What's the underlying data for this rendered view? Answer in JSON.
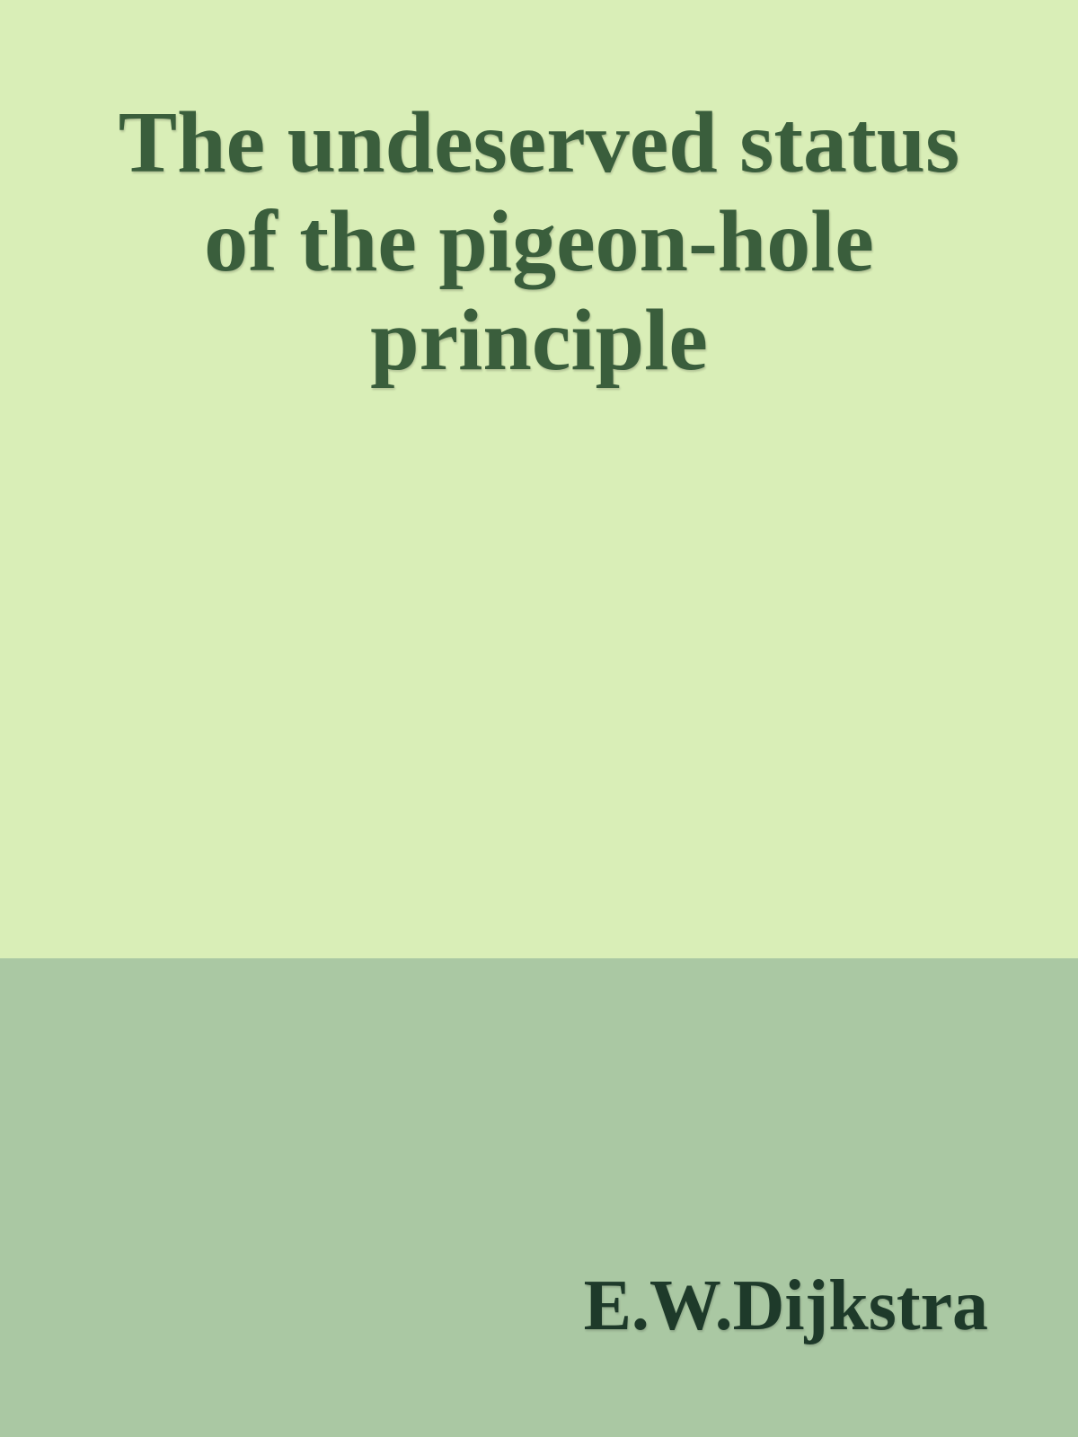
{
  "cover": {
    "title": "The undeserved status of the pigeon-hole principle",
    "author": "E.W.Dijkstra",
    "colors": {
      "top_background": "#d9eeb7",
      "bottom_background": "#aac8a3",
      "title_text": "#3a5e3c",
      "author_text": "#1e3a2a"
    }
  }
}
